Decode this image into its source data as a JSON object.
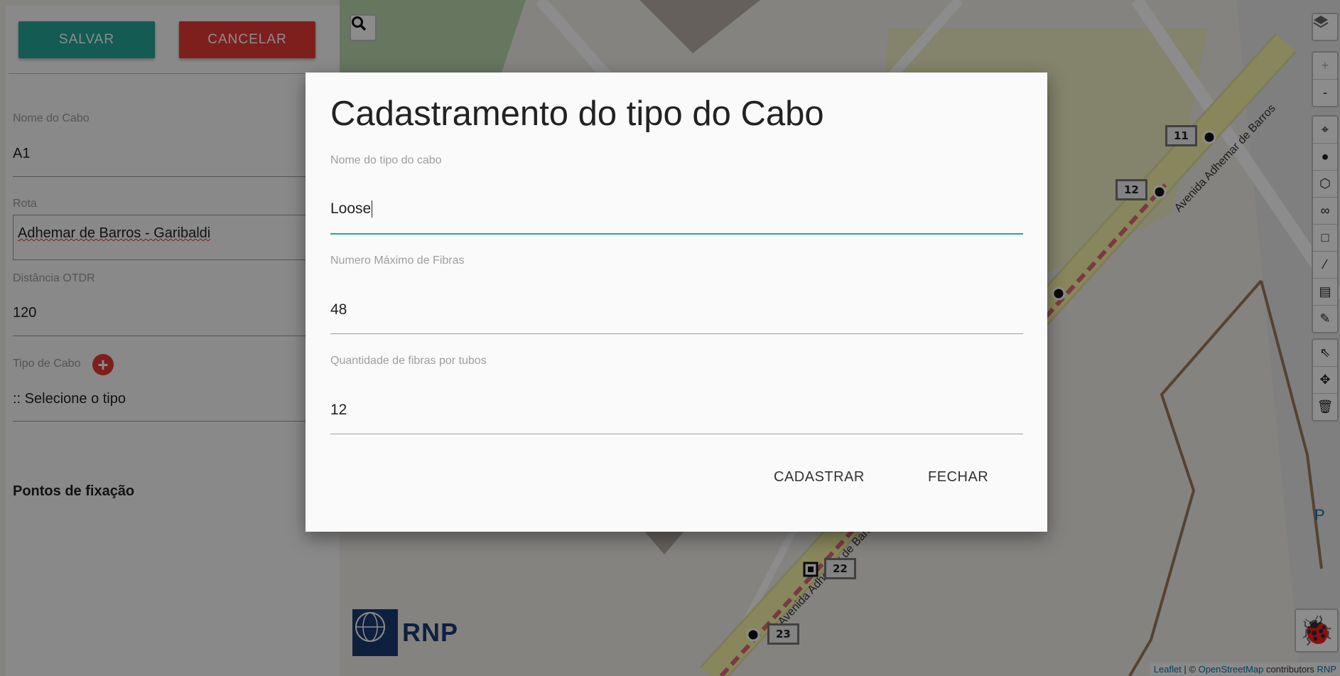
{
  "left_panel": {
    "save_label": "SALVAR",
    "cancel_label": "CANCELAR",
    "fields": [
      {
        "label": "Nome do Cabo",
        "value": "A1"
      },
      {
        "label": "Rota",
        "value": "Adhemar de Barros - Garibaldi"
      },
      {
        "label": "Distância OTDR",
        "value": "120"
      },
      {
        "label": "Tipo de Cabo",
        "value": ":: Selecione o tipo"
      }
    ],
    "add_icon": "plus-circle-icon",
    "fixation_title": "Pontos de fixação"
  },
  "map": {
    "search_icon": "search-icon",
    "layers_icon": "layers-icon",
    "zoom_in": "+",
    "zoom_out": "-",
    "street_name": "Avenida Adhemar de Barros",
    "markers": [
      "11",
      "12",
      "22",
      "23"
    ],
    "parking_label": "P",
    "logo_text": "RNP",
    "attribution": {
      "leaflet": "Leaflet",
      "sep": " | © ",
      "osm": "OpenStreetMap",
      "contributors": " contributors ",
      "rnp": "RNP"
    },
    "draw_tools": [
      "crosshair-icon",
      "circle-marker-icon",
      "polygon-icon",
      "polyline-icon",
      "rectangle-icon",
      "line-icon",
      "note-icon",
      "measure-icon",
      "select-icon",
      "move-icon",
      "trash-icon"
    ],
    "bug_icon": "bug-icon"
  },
  "modal": {
    "title": "Cadastramento do tipo do Cabo",
    "fields": [
      {
        "label": "Nome do tipo do cabo",
        "value": "Loose"
      },
      {
        "label": "Numero Máximo de Fibras",
        "value": "48"
      },
      {
        "label": "Quantidade de fibras por tubos",
        "value": "12"
      }
    ],
    "submit_label": "CADASTRAR",
    "close_label": "FECHAR"
  },
  "colors": {
    "primary": "#26a69a",
    "danger": "#e53935",
    "route": "#e0687a"
  }
}
